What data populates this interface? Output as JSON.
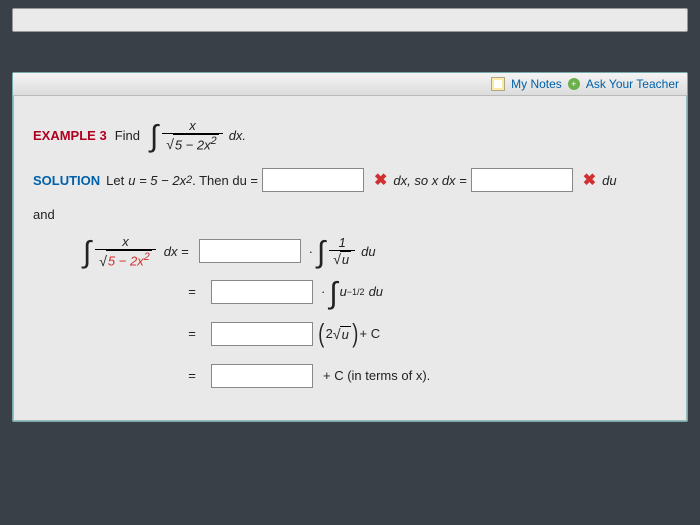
{
  "header": {
    "my_notes": "My Notes",
    "ask_teacher": "Ask Your Teacher"
  },
  "example": {
    "label": "EXAMPLE 3",
    "find": "Find",
    "integrand_num": "x",
    "integrand_den_inside": "5 − 2x",
    "dx": "dx."
  },
  "solution": {
    "label": "SOLUTION",
    "let": "Let",
    "u_eq": "u = 5 − 2x",
    "sq": "2",
    "then_du": ". Then  du =",
    "dx_so": "dx,  so  x dx =",
    "du_tail": "du",
    "and": "and"
  },
  "work": {
    "lhs_num": "x",
    "lhs_den_inside": "5 − 2x",
    "dx_eq": "dx  =",
    "step1_frac_num": "1",
    "step1_frac_den_u": "u",
    "step1_du": "du",
    "step2_u": "u",
    "step2_exp": "−1/2",
    "step2_du": "du",
    "step3_inside1": "2",
    "step3_inside_u": "u",
    "step3_plus_c": " + C",
    "step4_text": "+ C  (in terms of x)."
  },
  "symbols": {
    "eq": "=",
    "dot": "·",
    "x": "✖",
    "sq2": "2"
  }
}
